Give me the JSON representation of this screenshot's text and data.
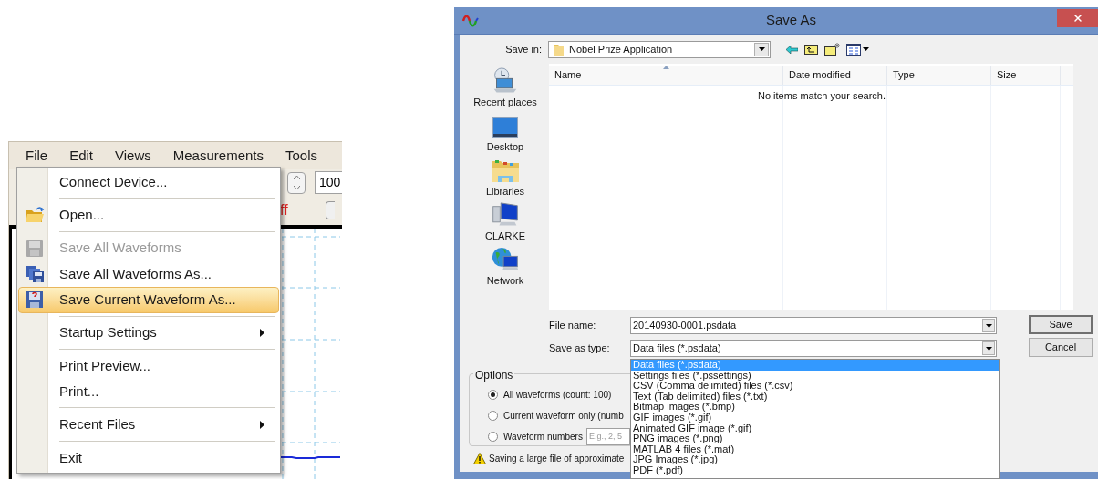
{
  "app": {
    "menu_bar": [
      "File",
      "Edit",
      "Views",
      "Measurements",
      "Tools"
    ],
    "toolbar": {
      "field_value": "100",
      "text": "ff"
    },
    "file_menu": [
      {
        "kind": "item",
        "label": "Connect Device...",
        "disabled": false,
        "selected": false,
        "submenu": false
      },
      {
        "kind": "separator"
      },
      {
        "kind": "item",
        "label": "Open...",
        "disabled": false,
        "selected": false,
        "submenu": false
      },
      {
        "kind": "separator"
      },
      {
        "kind": "item",
        "label": "Save All Waveforms",
        "disabled": true,
        "selected": false,
        "submenu": false
      },
      {
        "kind": "item",
        "label": "Save All Waveforms As...",
        "disabled": false,
        "selected": false,
        "submenu": false
      },
      {
        "kind": "item",
        "label": "Save Current Waveform As...",
        "disabled": false,
        "selected": true,
        "submenu": false
      },
      {
        "kind": "separator"
      },
      {
        "kind": "item",
        "label": "Startup Settings",
        "disabled": false,
        "selected": false,
        "submenu": true
      },
      {
        "kind": "separator"
      },
      {
        "kind": "item",
        "label": "Print Preview...",
        "disabled": false,
        "selected": false,
        "submenu": false
      },
      {
        "kind": "item",
        "label": "Print...",
        "disabled": false,
        "selected": false,
        "submenu": false
      },
      {
        "kind": "separator"
      },
      {
        "kind": "item",
        "label": "Recent Files",
        "disabled": false,
        "selected": false,
        "submenu": true
      },
      {
        "kind": "separator"
      },
      {
        "kind": "item",
        "label": "Exit",
        "disabled": false,
        "selected": false,
        "submenu": false
      }
    ]
  },
  "dialog": {
    "title": "Save As",
    "save_in": {
      "label": "Save in:",
      "value": "Nobel Prize Application"
    },
    "places": [
      "Recent places",
      "Desktop",
      "Libraries",
      "CLARKE",
      "Network"
    ],
    "columns": [
      "Name",
      "Date modified",
      "Type",
      "Size"
    ],
    "empty_message": "No items match your search.",
    "file_name": {
      "label": "File name:",
      "value": "20140930-0001.psdata"
    },
    "save_as_type": {
      "label": "Save as type:",
      "value": "Data files (*.psdata)",
      "options": [
        {
          "label": "Data files (*.psdata)",
          "selected": true
        },
        {
          "label": "Settings files (*.pssettings)",
          "selected": false
        },
        {
          "label": "CSV (Comma delimited) files (*.csv)",
          "selected": false
        },
        {
          "label": "Text (Tab delimited) files (*.txt)",
          "selected": false
        },
        {
          "label": "Bitmap images (*.bmp)",
          "selected": false
        },
        {
          "label": "GIF images (*.gif)",
          "selected": false
        },
        {
          "label": "Animated GIF image (*.gif)",
          "selected": false
        },
        {
          "label": "PNG images (*.png)",
          "selected": false
        },
        {
          "label": "MATLAB 4 files (*.mat)",
          "selected": false
        },
        {
          "label": "JPG Images (*.jpg)",
          "selected": false
        },
        {
          "label": "PDF (*.pdf)",
          "selected": false
        }
      ]
    },
    "buttons": [
      "Save",
      "Cancel"
    ],
    "options": {
      "legend": "Options",
      "radios": [
        {
          "label": "All waveforms (count: 100)",
          "selected": true
        },
        {
          "label": "Current waveform only (numb",
          "selected": false
        },
        {
          "label": "Waveform numbers",
          "selected": false,
          "placeholder": "E.g., 2, 5"
        }
      ]
    },
    "warning": "Saving a large file of approximate"
  }
}
